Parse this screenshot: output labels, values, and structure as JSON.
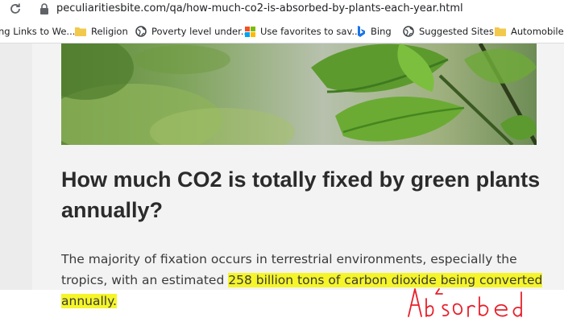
{
  "browser": {
    "url": "peculiaritiesbite.com/qa/how-much-co2-is-absorbed-by-plants-each-year.html",
    "bookmarks": [
      {
        "label": "ng Links to We...",
        "icon": "page-icon"
      },
      {
        "label": "Religion",
        "icon": "folder-icon"
      },
      {
        "label": "Poverty level under...",
        "icon": "globe-icon"
      },
      {
        "label": "Use favorites to sav...",
        "icon": "microsoft-icon"
      },
      {
        "label": "Bing",
        "icon": "bing-icon"
      },
      {
        "label": "Suggested Sites",
        "icon": "globe-icon"
      },
      {
        "label": "Automobile",
        "icon": "folder-icon"
      }
    ]
  },
  "article": {
    "heading": "How much CO2 is totally fixed by green plants annually?",
    "paragraph_before": "The majority of fixation occurs in terrestrial environments, especially the tropics, with an estimated ",
    "paragraph_highlight": "258 billion tons of carbon dioxide being converted annually.",
    "handwritten_note": "Absorbed"
  },
  "colors": {
    "highlight": "#f5f52a",
    "annotation_ink": "#e8202a",
    "heading": "#2b2b2b"
  }
}
